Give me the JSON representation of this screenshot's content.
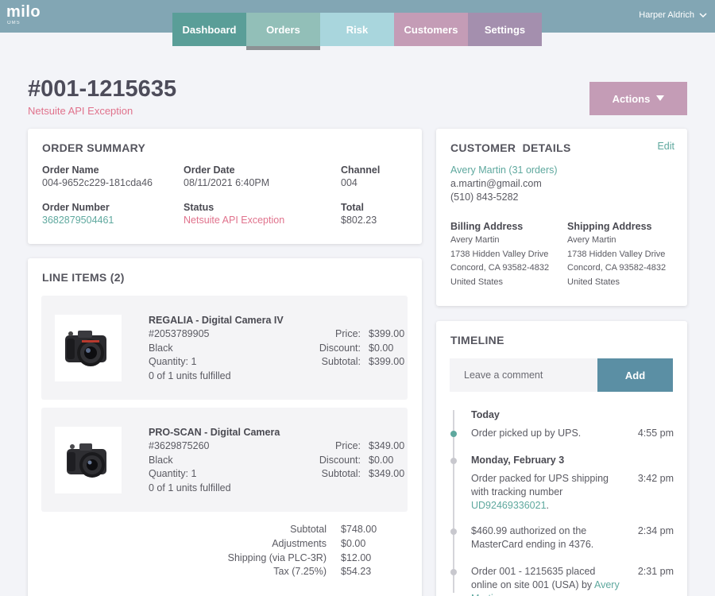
{
  "app": {
    "logo": "milo",
    "logo_sub": "OMS",
    "user": "Harper Aldrich"
  },
  "colors": {
    "topbar": "#82a6b4",
    "accent_link": "#5ea89e",
    "error": "#e0728c",
    "actions": "#c49cb6",
    "add": "#5b8fa4"
  },
  "nav": [
    {
      "label": "Dashboard",
      "color": "#5a9e98"
    },
    {
      "label": "Orders",
      "color": "#92bfb8"
    },
    {
      "label": "Risk",
      "color": "#a9d6dd"
    },
    {
      "label": "Customers",
      "color": "#c49cb6"
    },
    {
      "label": "Settings",
      "color": "#a48fae"
    }
  ],
  "order": {
    "id": "#001-1215635",
    "status_sub": "Netsuite API Exception",
    "actions_label": "Actions"
  },
  "summary": {
    "title": "ORDER SUMMARY",
    "order_name_label": "Order Name",
    "order_name": "004-9652c229-181cda46",
    "order_date_label": "Order Date",
    "order_date": "08/11/2021 6:40PM",
    "channel_label": "Channel",
    "channel": "004",
    "order_number_label": "Order Number",
    "order_number": "3682879504461",
    "status_label": "Status",
    "status": "Netsuite API Exception",
    "total_label": "Total",
    "total": "$802.23"
  },
  "line_items": {
    "title": "LINE ITEMS (2)",
    "price_label": "Price:",
    "discount_label": "Discount:",
    "subtotal_label": "Subtotal:",
    "items": [
      {
        "name": "REGALIA - Digital Camera IV",
        "sku": "#2053789905",
        "color": "Black",
        "quantity": "Quantity: 1",
        "fulfilled": "0 of 1 units fulfilled",
        "price": "$399.00",
        "discount": "$0.00",
        "subtotal": "$399.00"
      },
      {
        "name": "PRO-SCAN - Digital Camera",
        "sku": "#3629875260",
        "color": "Black",
        "quantity": "Quantity: 1",
        "fulfilled": "0 of 1 units fulfilled",
        "price": "$349.00",
        "discount": "$0.00",
        "subtotal": "$349.00"
      }
    ],
    "totals": [
      {
        "label": "Subtotal",
        "value": "$748.00"
      },
      {
        "label": "Adjustments",
        "value": "$0.00"
      },
      {
        "label": "Shipping (via PLC-3R)",
        "value": "$12.00"
      },
      {
        "label": "Tax (7.25%)",
        "value": "$54.23"
      }
    ]
  },
  "customer": {
    "title": "CUSTOMER  DETAILS",
    "edit": "Edit",
    "name": "Avery Martin (31 orders)",
    "email": "a.martin@gmail.com",
    "phone": "(510) 843-5282",
    "billing_label": "Billing Address",
    "shipping_label": "Shipping Address",
    "billing": [
      "Avery Martin",
      "1738 Hidden Valley Drive",
      "Concord, CA 93582-4832",
      "United States"
    ],
    "shipping": [
      "Avery Martin",
      "1738 Hidden Valley Drive",
      "Concord, CA 93582-4832",
      "United States"
    ]
  },
  "timeline": {
    "title": "TIMELINE",
    "comment_placeholder": "Leave a comment",
    "add_label": "Add",
    "today": "Today",
    "today_event": "Order picked up by UPS.",
    "today_time": "4:55 pm",
    "day2": "Monday, February 3",
    "event2_text": "Order packed for UPS shipping with tracking number",
    "event2_link": "UD92469336021",
    "event2_time": "3:42 pm",
    "event3": "$460.99 authorized on the MasterCard ending in 4376.",
    "event3_time": "2:34 pm",
    "event4_text": "Order 001 - 1215635 placed online on site 001 (USA) by",
    "event4_link": "Avery Martin",
    "event4_time": "2:31 pm"
  }
}
